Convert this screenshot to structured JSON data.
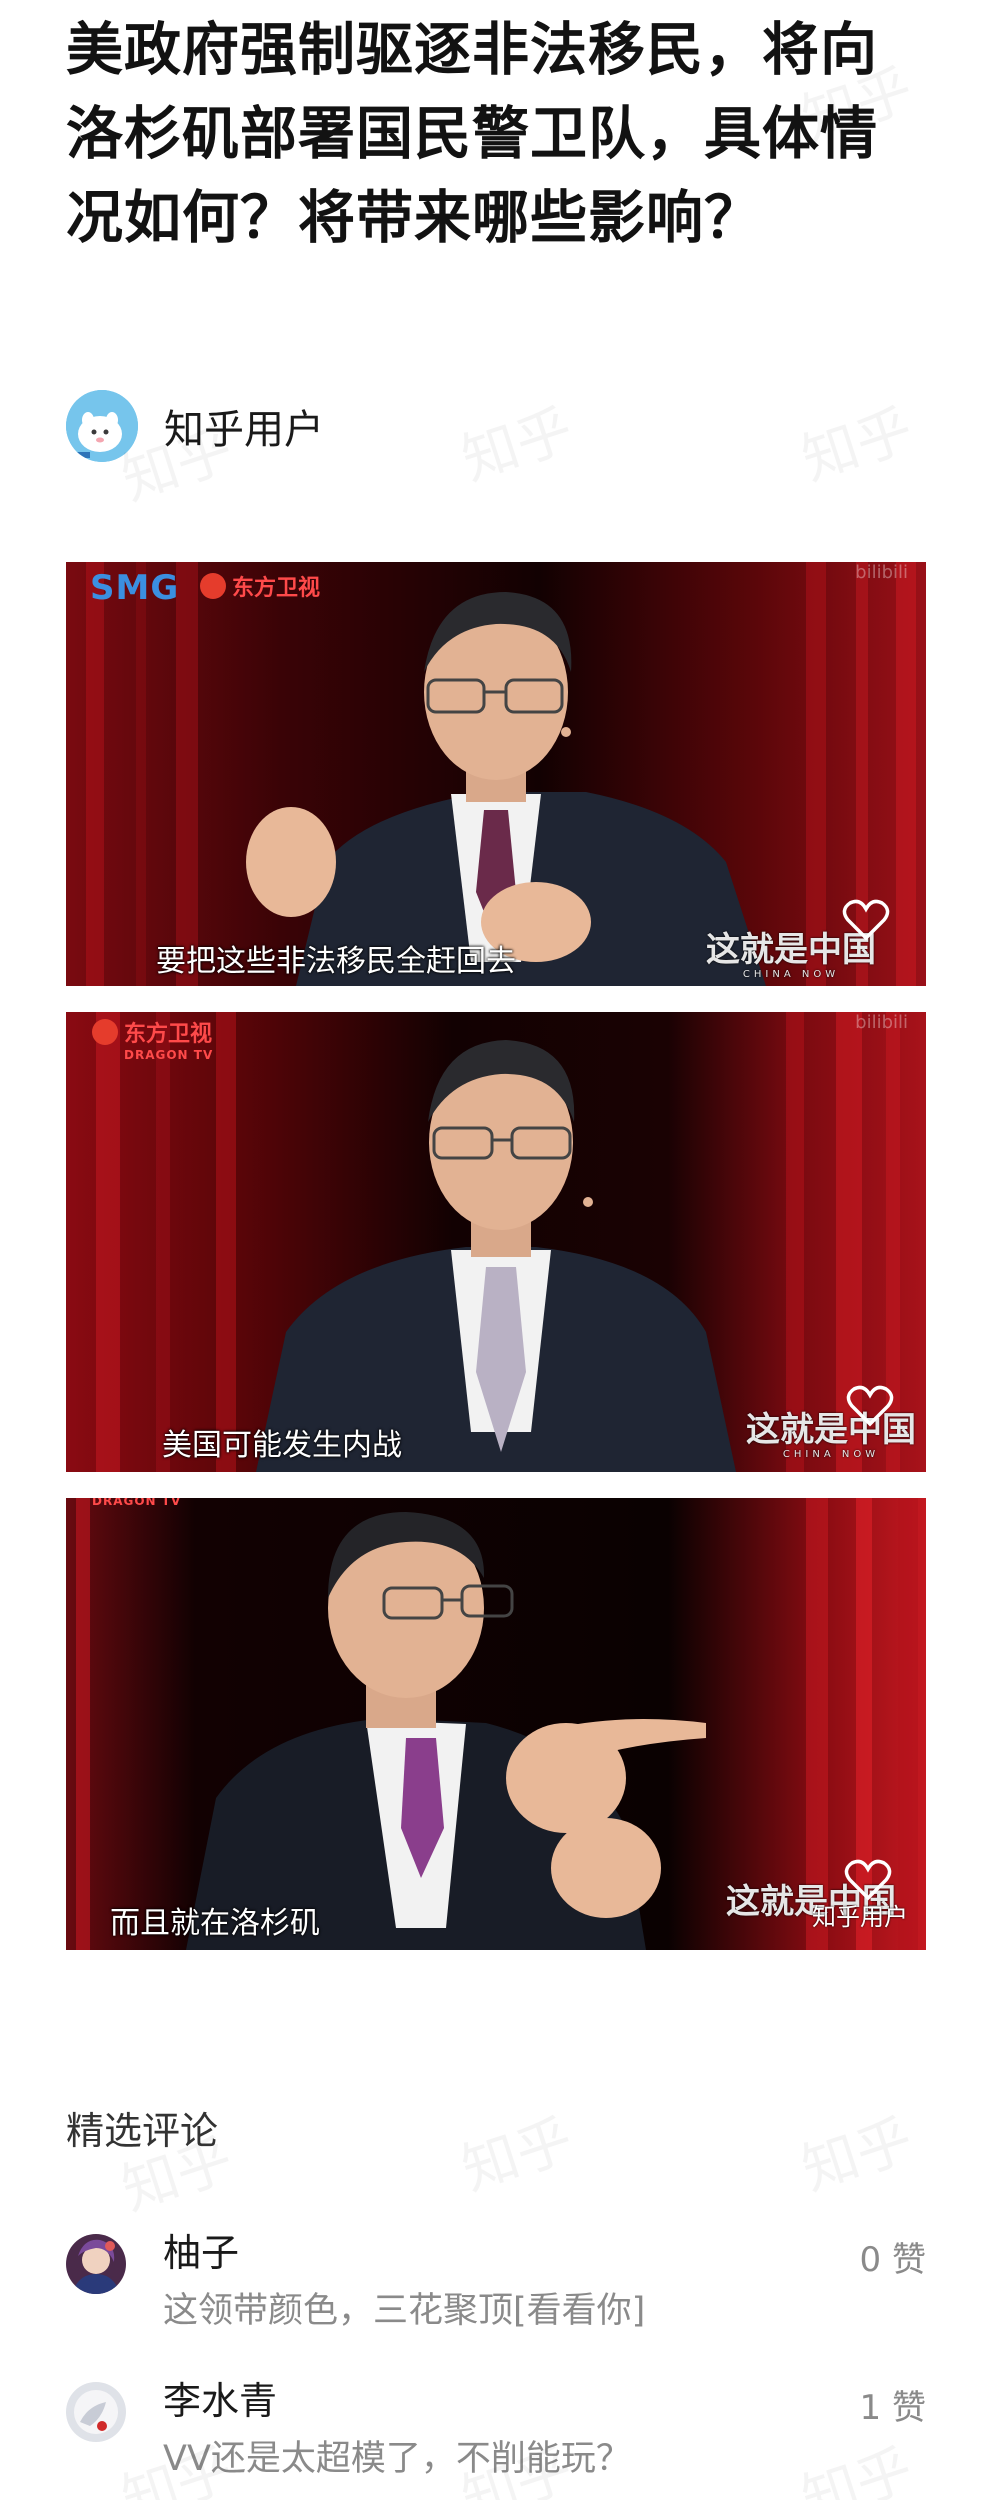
{
  "question": {
    "title": "美政府强制驱逐非法移民，将向洛杉矶部署国民警卫队，具体情况如何？将带来哪些影响？"
  },
  "author": {
    "name": "知乎用户"
  },
  "watermark_text": "知乎",
  "videos": [
    {
      "subtitle": "要把这些非法移民全赶回去",
      "channel_logo": "SMG",
      "channel_name": "东方卫视",
      "site_logo": "bilibili",
      "show_logo": "这就是中国",
      "show_logo_en": "CHINA NOW"
    },
    {
      "subtitle": "美国可能发生内战",
      "channel_name": "东方卫视",
      "channel_name_en": "DRAGON TV",
      "site_logo": "bilibili",
      "show_logo": "这就是中国",
      "show_logo_en": "CHINA NOW"
    },
    {
      "subtitle": "而且就在洛杉矶",
      "channel_name_en": "DRAGON TV",
      "show_logo": "这就是中国",
      "watermark": "知乎用户"
    }
  ],
  "comments": {
    "header": "精选评论",
    "items": [
      {
        "name": "柚子",
        "text": "这领带颜色，三花聚顶[看看你]",
        "likes": "0 赞"
      },
      {
        "name": "李水青",
        "text": "VV还是太超模了，不削能玩？",
        "likes": "1 赞"
      }
    ]
  },
  "colors": {
    "title": "#121212",
    "muted": "#8a8a8a",
    "stage_red": "#b3121a",
    "tie_purple": "#7a3a78",
    "suit": "#1f2533"
  }
}
